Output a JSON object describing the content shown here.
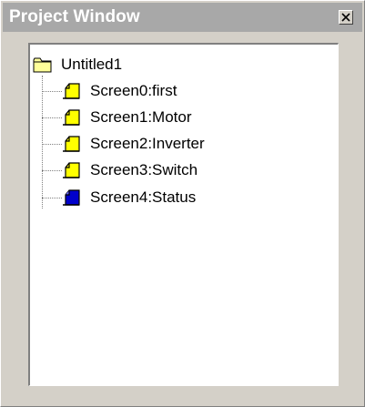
{
  "window": {
    "title": "Project Window",
    "close_icon": "close-icon"
  },
  "tree": {
    "root": {
      "label": "Untitled1",
      "icon": "folder-icon"
    },
    "items": [
      {
        "label": "Screen0:first",
        "icon": "screen-page-icon",
        "color": "#ffff00"
      },
      {
        "label": "Screen1:Motor",
        "icon": "screen-page-icon",
        "color": "#ffff00"
      },
      {
        "label": "Screen2:Inverter",
        "icon": "screen-page-icon",
        "color": "#ffff00"
      },
      {
        "label": "Screen3:Switch",
        "icon": "screen-page-icon",
        "color": "#ffff00"
      },
      {
        "label": "Screen4:Status",
        "icon": "screen-page-icon",
        "color": "#0000cc"
      }
    ]
  }
}
